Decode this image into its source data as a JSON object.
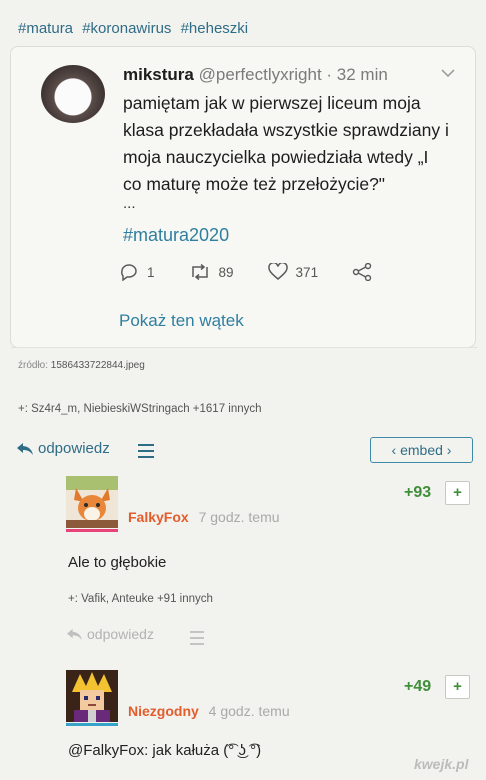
{
  "tags": [
    "#matura",
    "#koronawirus",
    "#heheszki"
  ],
  "tweet": {
    "name": "mikstura",
    "handle": "@perfectlyxright · 32 min",
    "lines": [
      "pamiętam jak w pierwszej liceum moja",
      "klasa przekładała wszystkie sprawdziany i",
      "moja nauczycielka powiedziała wtedy „I",
      "co maturę może też przełożycie?\""
    ],
    "ellipsis": "...",
    "hashtag": "#matura2020",
    "replies": "1",
    "retweets": "89",
    "likes": "371",
    "show_thread": "Pokaż ten wątek"
  },
  "source": {
    "label": "źródło:",
    "file": "1586433722844.jpeg"
  },
  "plus_users": "+: Sz4r4_m, NiebieskiWStringach +1617 innych",
  "post_actions": {
    "reply": "odpowiedz",
    "embed": "‹ embed ›"
  },
  "comments": [
    {
      "user": "FalkyFox",
      "time": "7 godz. temu",
      "score": "+93",
      "plus_btn": "+",
      "text": "Ale to głębokie",
      "plus_users": "+: Vafik, Anteuke +91 innych",
      "reply": "odpowiedz",
      "bar_color": "#e8447a"
    },
    {
      "user": "Niezgodny",
      "time": "4 godz. temu",
      "score": "+49",
      "plus_btn": "+",
      "text": "@FalkyFox: jak kałuża (͡° ͜ʖ ͡°)",
      "bar_color": "#36a4c8"
    }
  ],
  "watermark": "kwejk.pl",
  "colors": {
    "link": "#2f6d86",
    "username": "#e35d2c",
    "score": "#3f8f3a"
  }
}
